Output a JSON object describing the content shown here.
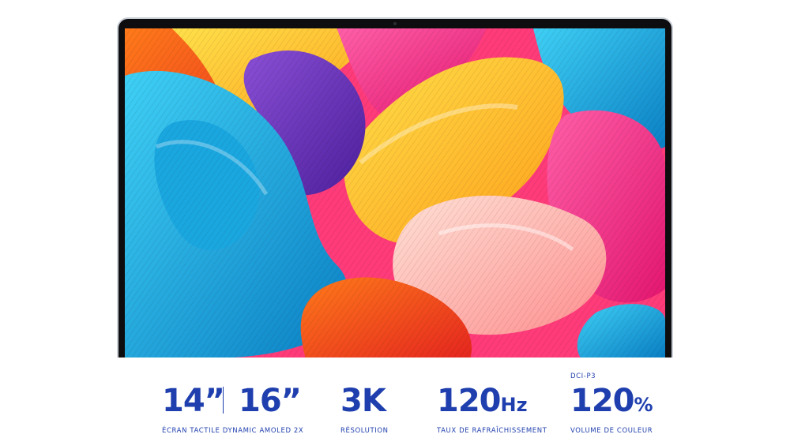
{
  "specs": {
    "size_small": "14”",
    "size_large": "16”",
    "size_caption": "ÉCRAN TACTILE DYNAMIC AMOLED 2X",
    "resolution_value": "3K",
    "resolution_caption": "RÉSOLUTION",
    "refresh_value": "120",
    "refresh_unit": "Hz",
    "refresh_caption": "TAUX DE RAFRAÎCHISSEMENT",
    "color_prefix": "DCI-P3",
    "color_value": "120",
    "color_unit": "%",
    "color_caption": "VOLUME DE COULEUR"
  },
  "colors": {
    "accent": "#1f3fae",
    "bezel": "#0d0d0f",
    "frame": "#c9ced6"
  },
  "icons": {
    "screen_artwork": "abstract-colorful-waves-wallpaper"
  }
}
